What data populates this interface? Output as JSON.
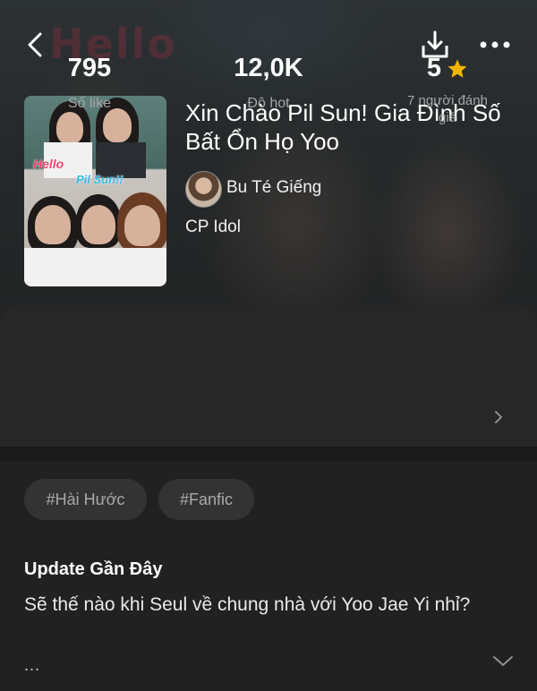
{
  "header": {
    "back_icon": "chevron-left-icon",
    "download_icon": "download-icon",
    "more_icon": "more-horizontal-icon",
    "cover_text_line1": "Hello",
    "cover_text_line2": "Pil Sun!!"
  },
  "story": {
    "title": "Xin Chào Pil Sun! Gia Đình Số Bất Ổn Họ Yoo",
    "author": "Bu Té Giếng",
    "genre": "CP Idol"
  },
  "stats": {
    "likes_value": "795",
    "likes_label": "Số like",
    "hot_value": "12,0K",
    "hot_label": "Độ hot",
    "rating_value": "5",
    "rating_star_icon": "star-icon",
    "rating_count_label": "7 người đánh giá",
    "star_color": "#f5b400"
  },
  "tags": [
    "#Hài Hước",
    "#Fanfic"
  ],
  "update": {
    "heading": "Update Gần Đây",
    "text": "Sẽ thế nào khi Seul về chung nhà với Yoo Jae Yi nhỉ?",
    "ellipsis": "..."
  }
}
